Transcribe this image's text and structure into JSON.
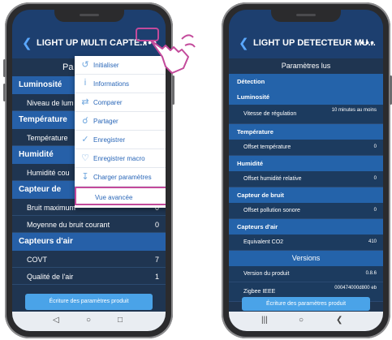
{
  "left_phone": {
    "title": "LIGHT UP MULTI CAPTE...",
    "more_label": "•••",
    "page_title": "Pa",
    "sections": [
      {
        "name": "Luminosité",
        "rows": [
          {
            "label": "Niveau de lum",
            "value": ""
          }
        ]
      },
      {
        "name": "Température",
        "rows": [
          {
            "label": "Température",
            "value": ""
          }
        ]
      },
      {
        "name": "Humidité",
        "rows": [
          {
            "label": "Humidité cou",
            "value": ""
          }
        ]
      },
      {
        "name": "Capteur de",
        "rows": [
          {
            "label": "Bruit maximum",
            "value": "0"
          },
          {
            "label": "Moyenne du bruit courant",
            "value": "0"
          }
        ]
      },
      {
        "name": "Capteurs d'air",
        "rows": [
          {
            "label": "COVT",
            "value": "7"
          },
          {
            "label": "Qualité de l'air",
            "value": "1"
          }
        ]
      }
    ],
    "button_label": "Écriture des paramètres produit",
    "menu": [
      {
        "icon": "refresh-icon",
        "label": "Initialiser"
      },
      {
        "icon": "info-icon",
        "label": "Informations"
      },
      {
        "icon": "compare-icon",
        "label": "Comparer"
      },
      {
        "icon": "share-icon",
        "label": "Partager"
      },
      {
        "icon": "check-icon",
        "label": "Enregistrer"
      },
      {
        "icon": "heart-icon",
        "label": "Enregistrer macro"
      },
      {
        "icon": "download-icon",
        "label": "Charger paramètres"
      },
      {
        "icon": "",
        "label": "Vue avancée"
      }
    ]
  },
  "right_phone": {
    "title": "LIGHT UP DETECTEUR MU...",
    "more_label": "•••",
    "page_title": "Paramètres lus",
    "sections": [
      {
        "name": "Détection",
        "rows": []
      },
      {
        "name": "Luminosité",
        "rows": [
          {
            "label": "Vitesse de régulation",
            "value": "10 minutes au moins"
          }
        ]
      },
      {
        "name": "Température",
        "rows": [
          {
            "label": "Offset température",
            "value": "0"
          }
        ]
      },
      {
        "name": "Humidité",
        "rows": [
          {
            "label": "Offset humidité relative",
            "value": "0"
          }
        ]
      },
      {
        "name": "Capteur de bruit",
        "rows": [
          {
            "label": "Offset pollution sonore",
            "value": "0"
          }
        ]
      },
      {
        "name": "Capteurs d'air",
        "rows": [
          {
            "label": "Equivalent CO2",
            "value": "410"
          }
        ]
      }
    ],
    "versions_title": "Versions",
    "versions": [
      {
        "label": "Version du produit",
        "value": "0.8.6"
      },
      {
        "label": "Zigbee IEEE",
        "value": "000474000d800 eb"
      }
    ],
    "button_label": "Écriture des paramètres produit"
  },
  "colors": {
    "header": "#1d3f6f",
    "section": "#2660a8",
    "background": "#1f3551",
    "button": "#4aa3e8",
    "menu_text": "#2a67b8",
    "highlight": "#c34a9b"
  }
}
